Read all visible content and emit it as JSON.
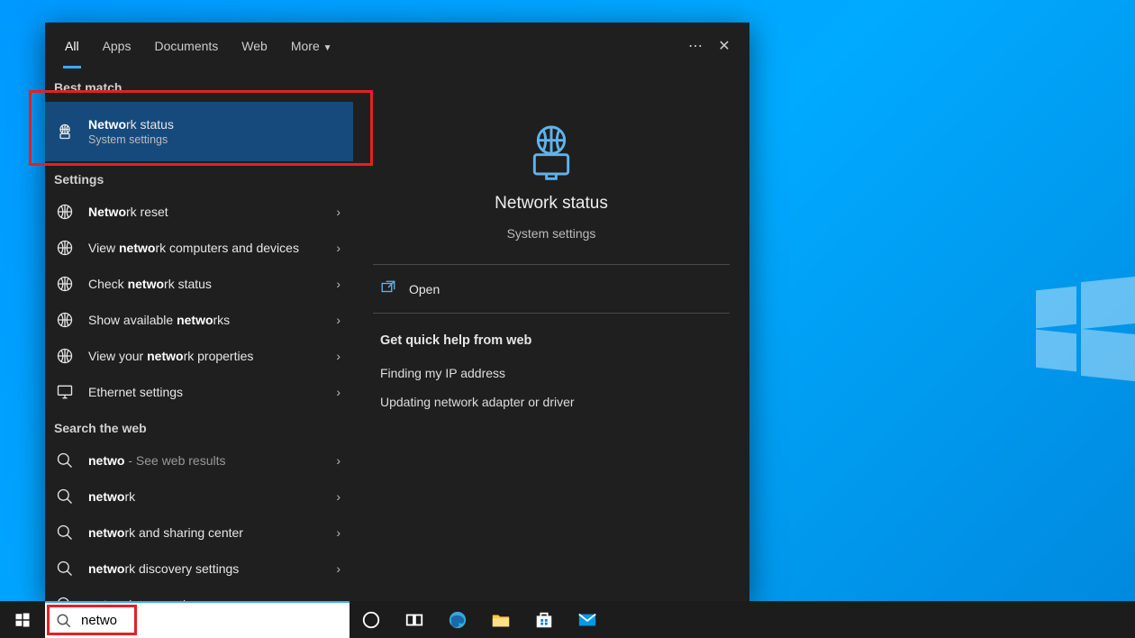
{
  "tabs": [
    "All",
    "Apps",
    "Documents",
    "Web",
    "More"
  ],
  "best_match_header": "Best match",
  "best": {
    "title_pre": "Netwo",
    "title_post": "rk status",
    "sub": "System settings"
  },
  "settings_header": "Settings",
  "settings": [
    {
      "pre": "Netwo",
      "post": "rk reset"
    },
    {
      "pre_plain": "View ",
      "pre": "netwo",
      "post": "rk computers and devices"
    },
    {
      "pre_plain": "Check ",
      "pre": "netwo",
      "post": "rk status"
    },
    {
      "pre_plain": "Show available ",
      "pre": "netwo",
      "post": "rks"
    },
    {
      "pre_plain": "View your ",
      "pre": "netwo",
      "post": "rk properties"
    },
    {
      "plain": "Ethernet settings",
      "icon": "monitor"
    }
  ],
  "web_header": "Search the web",
  "web": [
    {
      "pre": "netwo",
      "post": "",
      "trail": " - See web results"
    },
    {
      "pre": "netwo",
      "post": "rk"
    },
    {
      "pre": "netwo",
      "post": "rk and sharing center"
    },
    {
      "pre": "netwo",
      "post": "rk discovery settings"
    },
    {
      "pre": "netwo",
      "post": "rk connections"
    }
  ],
  "preview": {
    "title": "Network status",
    "sub": "System settings",
    "open": "Open",
    "quick_header": "Get quick help from web",
    "help": [
      "Finding my IP address",
      "Updating network adapter or driver"
    ]
  },
  "search_value": "netwo"
}
